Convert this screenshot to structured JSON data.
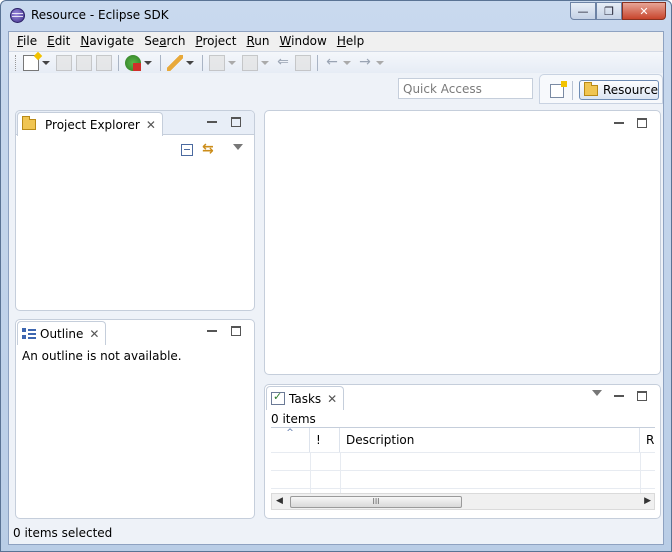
{
  "window": {
    "title": "Resource - Eclipse SDK",
    "controls": [
      "—",
      "❐",
      "✕"
    ]
  },
  "menubar": [
    {
      "pre": "",
      "u": "F",
      "post": "ile"
    },
    {
      "pre": "",
      "u": "E",
      "post": "dit"
    },
    {
      "pre": "",
      "u": "N",
      "post": "avigate"
    },
    {
      "pre": "Se",
      "u": "a",
      "post": "rch"
    },
    {
      "pre": "",
      "u": "P",
      "post": "roject"
    },
    {
      "pre": "",
      "u": "R",
      "post": "un"
    },
    {
      "pre": "",
      "u": "W",
      "post": "indow"
    },
    {
      "pre": "",
      "u": "H",
      "post": "elp"
    }
  ],
  "toolbar": {
    "quick_access_placeholder": "Quick Access",
    "perspective": "Resource"
  },
  "project_explorer": {
    "tab": "Project Explorer"
  },
  "outline": {
    "tab": "Outline",
    "message": "An outline is not available."
  },
  "tasks": {
    "tab": "Tasks",
    "count": "0 items",
    "columns": {
      "sort": "^",
      "priority": "!",
      "description": "Description",
      "resource": "R"
    },
    "scroll_grip": "III"
  },
  "status": {
    "text": "0 items selected"
  }
}
